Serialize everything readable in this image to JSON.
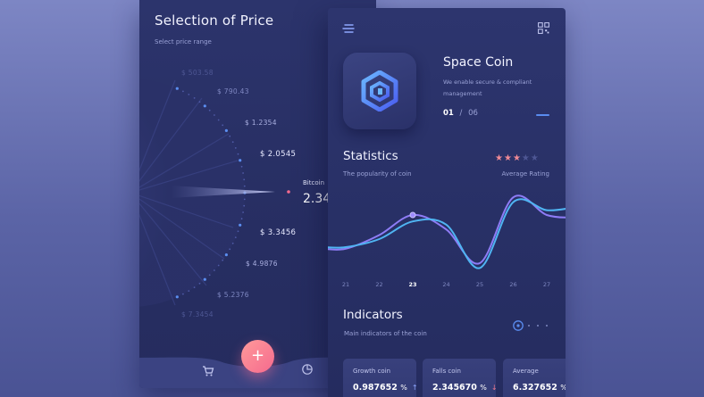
{
  "left": {
    "title": "Selection of Price",
    "subtitle": "Select price range",
    "prices": [
      "$ 503.58",
      "$ 790.43",
      "$ 1.2354",
      "$ 2.0545",
      "$ 3.3456",
      "$ 4.9876",
      "$ 5.2376",
      "$ 7.3454"
    ],
    "selected": {
      "label": "Bitcoin",
      "value": "2.34"
    },
    "fab_label": "+"
  },
  "right": {
    "coin": {
      "name": "Space Coin",
      "description": "We enable secure & compliant management",
      "page_current": "01",
      "page_sep": "/",
      "page_total": "06"
    },
    "statistics": {
      "title": "Statistics",
      "subtitle": "The popularity of coin",
      "rating_label": "Average Rating",
      "rating": 3,
      "rating_max": 5
    },
    "chart_data": {
      "type": "line",
      "x": [
        "21",
        "22",
        "23",
        "24",
        "25",
        "26",
        "27"
      ],
      "highlight_x": "23",
      "series": [
        {
          "color": "#8e7cf6",
          "values": [
            0.28,
            0.45,
            0.7,
            0.52,
            0.1,
            0.92,
            0.7
          ]
        },
        {
          "color": "#4fb4f2",
          "values": [
            0.3,
            0.4,
            0.62,
            0.58,
            0.04,
            0.86,
            0.76
          ]
        }
      ],
      "ylim": [
        0,
        1
      ]
    },
    "indicators": {
      "title": "Indicators",
      "subtitle": "Main indicators of the coin",
      "cards": [
        {
          "label": "Growth coin",
          "value": "0.987652",
          "unit": "%",
          "trend": "↑"
        },
        {
          "label": "Falls coin",
          "value": "2.345670",
          "unit": "%",
          "trend": "↓"
        },
        {
          "label": "Average",
          "value": "6.327652",
          "unit": "%",
          "trend": ""
        }
      ]
    }
  },
  "colors": {
    "accent": "#f56a8e",
    "line_purple": "#8e7cf6",
    "line_blue": "#4fb4f2",
    "star": "#f08a95"
  },
  "icons": [
    "menu-icon",
    "qr-code-icon",
    "cart-icon",
    "pie-chart-icon",
    "coin-logo-icon",
    "plus-icon"
  ]
}
